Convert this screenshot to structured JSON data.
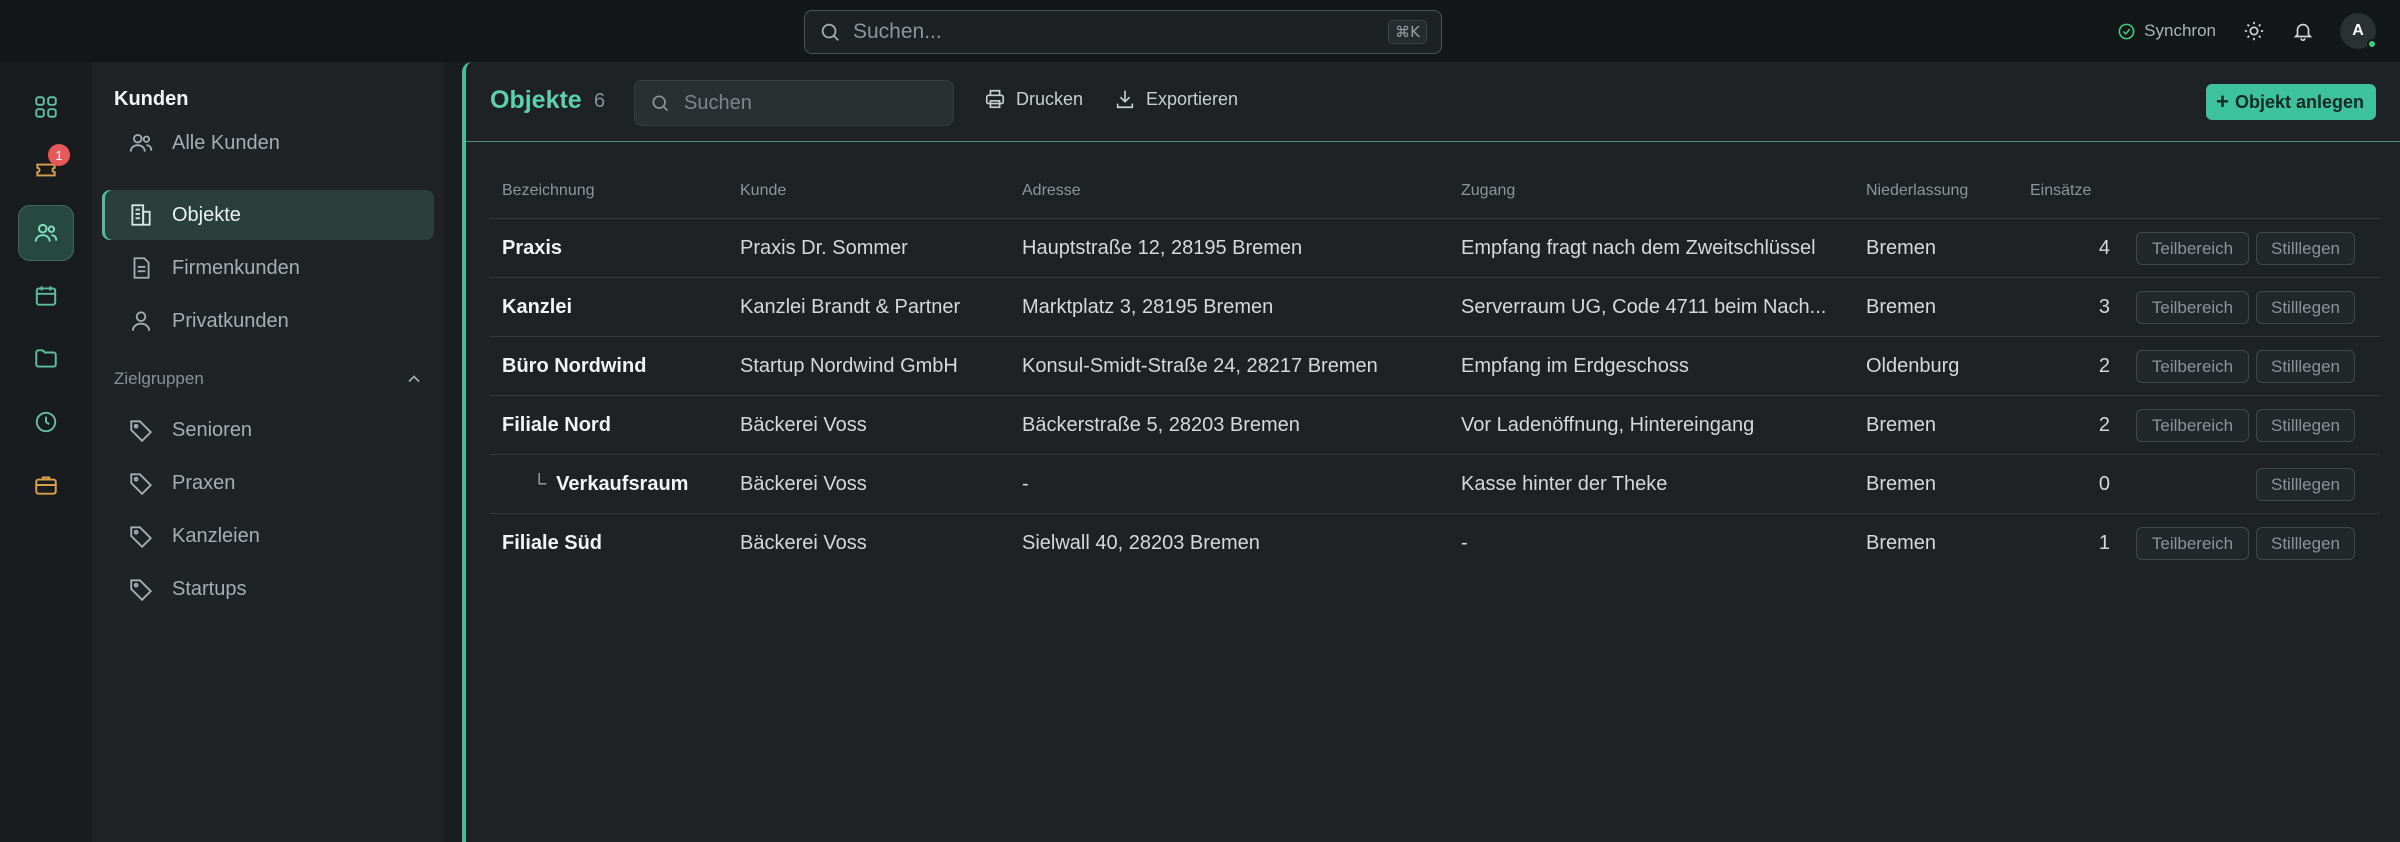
{
  "topbar": {
    "search_placeholder": "Suchen...",
    "shortcut": "⌘K",
    "sync_label": "Synchron",
    "avatar_initial": "A"
  },
  "rail": {
    "notification_badge": "1"
  },
  "sidebar": {
    "title": "Kunden",
    "items": [
      {
        "label": "Alle Kunden",
        "icon": "users-icon"
      },
      {
        "label": "Objekte",
        "icon": "building-icon"
      },
      {
        "label": "Firmenkunden",
        "icon": "document-icon"
      },
      {
        "label": "Privatkunden",
        "icon": "user-icon"
      }
    ],
    "section_label": "Zielgruppen",
    "groups": [
      {
        "label": "Senioren",
        "icon": "tag-icon"
      },
      {
        "label": "Praxen",
        "icon": "tag-icon"
      },
      {
        "label": "Kanzleien",
        "icon": "tag-icon"
      },
      {
        "label": "Startups",
        "icon": "tag-icon"
      }
    ]
  },
  "main": {
    "title": "Objekte",
    "count": "6",
    "search_placeholder": "Suchen",
    "print_label": "Drucken",
    "export_label": "Exportieren",
    "create_label": "Objekt anlegen"
  },
  "table": {
    "headers": [
      "Bezeichnung",
      "Kunde",
      "Adresse",
      "Zugang",
      "Niederlassung",
      "Einsätze"
    ],
    "rows": [
      {
        "name": "Praxis",
        "kunde": "Praxis Dr. Sommer",
        "adresse": "Hauptstraße 12, 28195 Bremen",
        "zugang": "Empfang fragt nach dem Zweitschlüssel",
        "niederlassung": "Bremen",
        "einsaetze": "4",
        "sub": false,
        "teilbereich": "Teilbereich",
        "stilllegen": "Stilllegen"
      },
      {
        "name": "Kanzlei",
        "kunde": "Kanzlei Brandt & Partner",
        "adresse": "Marktplatz 3, 28195 Bremen",
        "zugang": "Serverraum UG, Code 4711 beim Nach...",
        "niederlassung": "Bremen",
        "einsaetze": "3",
        "sub": false,
        "teilbereich": "Teilbereich",
        "stilllegen": "Stilllegen"
      },
      {
        "name": "Büro Nordwind",
        "kunde": "Startup Nordwind GmbH",
        "adresse": "Konsul-Smidt-Straße 24, 28217 Bremen",
        "zugang": "Empfang im Erdgeschoss",
        "niederlassung": "Oldenburg",
        "einsaetze": "2",
        "sub": false,
        "teilbereich": "Teilbereich",
        "stilllegen": "Stilllegen"
      },
      {
        "name": "Filiale Nord",
        "kunde": "Bäckerei Voss",
        "adresse": "Bäckerstraße 5, 28203 Bremen",
        "zugang": "Vor Ladenöffnung, Hintereingang",
        "niederlassung": "Bremen",
        "einsaetze": "2",
        "sub": false,
        "teilbereich": "Teilbereich",
        "stilllegen": "Stilllegen"
      },
      {
        "name": "Verkaufsraum",
        "prefix": "└",
        "kunde": "Bäckerei Voss",
        "adresse": "-",
        "zugang": "Kasse hinter der Theke",
        "niederlassung": "Bremen",
        "einsaetze": "0",
        "sub": true,
        "stilllegen": "Stilllegen"
      },
      {
        "name": "Filiale Süd",
        "kunde": "Bäckerei Voss",
        "adresse": "Sielwall 40, 28203 Bremen",
        "zugang": "-",
        "niederlassung": "Bremen",
        "einsaetze": "1",
        "sub": false,
        "teilbereich": "Teilbereich",
        "stilllegen": "Stilllegen"
      }
    ]
  },
  "colors": {
    "accent": "#3ec29c",
    "badge": "#e5595a",
    "online": "#3ecb78"
  }
}
